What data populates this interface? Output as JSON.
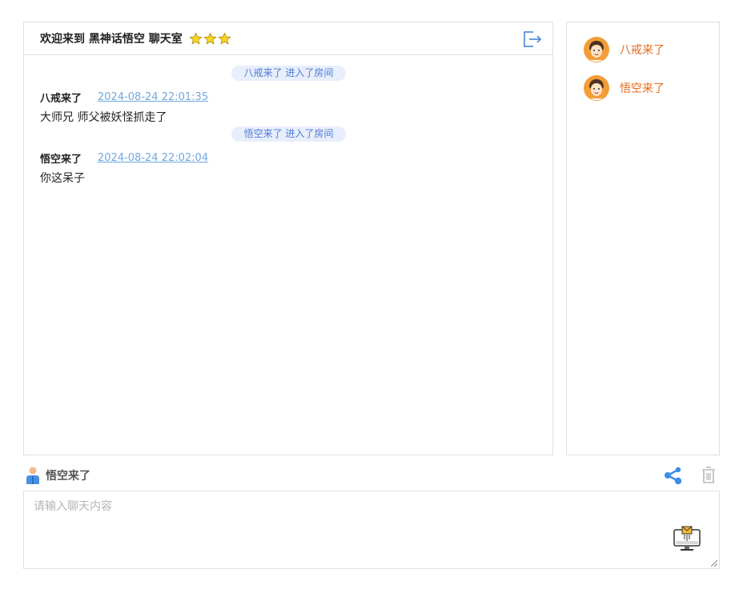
{
  "header": {
    "title": "欢迎来到 黑神话悟空 聊天室",
    "stars": 3,
    "icons": [
      "star-icon",
      "exit-icon"
    ]
  },
  "messages": [
    {
      "type": "notice",
      "text": "八戒来了 进入了房间"
    },
    {
      "type": "message",
      "user": "八戒来了",
      "time": "2024-08-24 22:01:35",
      "text": "大师兄 师父被妖怪抓走了"
    },
    {
      "type": "notice",
      "text": "悟空来了 进入了房间"
    },
    {
      "type": "message",
      "user": "悟空来了",
      "time": "2024-08-24 22:02:04",
      "text": "你这呆子"
    }
  ],
  "online_users": [
    {
      "name": "八戒来了",
      "icon": "avatar-icon"
    },
    {
      "name": "悟空来了",
      "icon": "avatar-icon"
    }
  ],
  "current_user": {
    "name": "悟空来了",
    "icon": "user-icon"
  },
  "toolbar": {
    "icons": [
      "share-icon",
      "trash-icon"
    ]
  },
  "input": {
    "placeholder": "请输入聊天内容",
    "value": ""
  },
  "send": {
    "icon": "send-computer-icon"
  },
  "colors": {
    "accent": "#4f7cd6",
    "notice_bg": "#e8eefb",
    "username": "#e86a1a",
    "timestamp": "#6fa8dc",
    "star": "#f5d623",
    "share": "#3b8ee8",
    "border": "#dcdfe6"
  }
}
